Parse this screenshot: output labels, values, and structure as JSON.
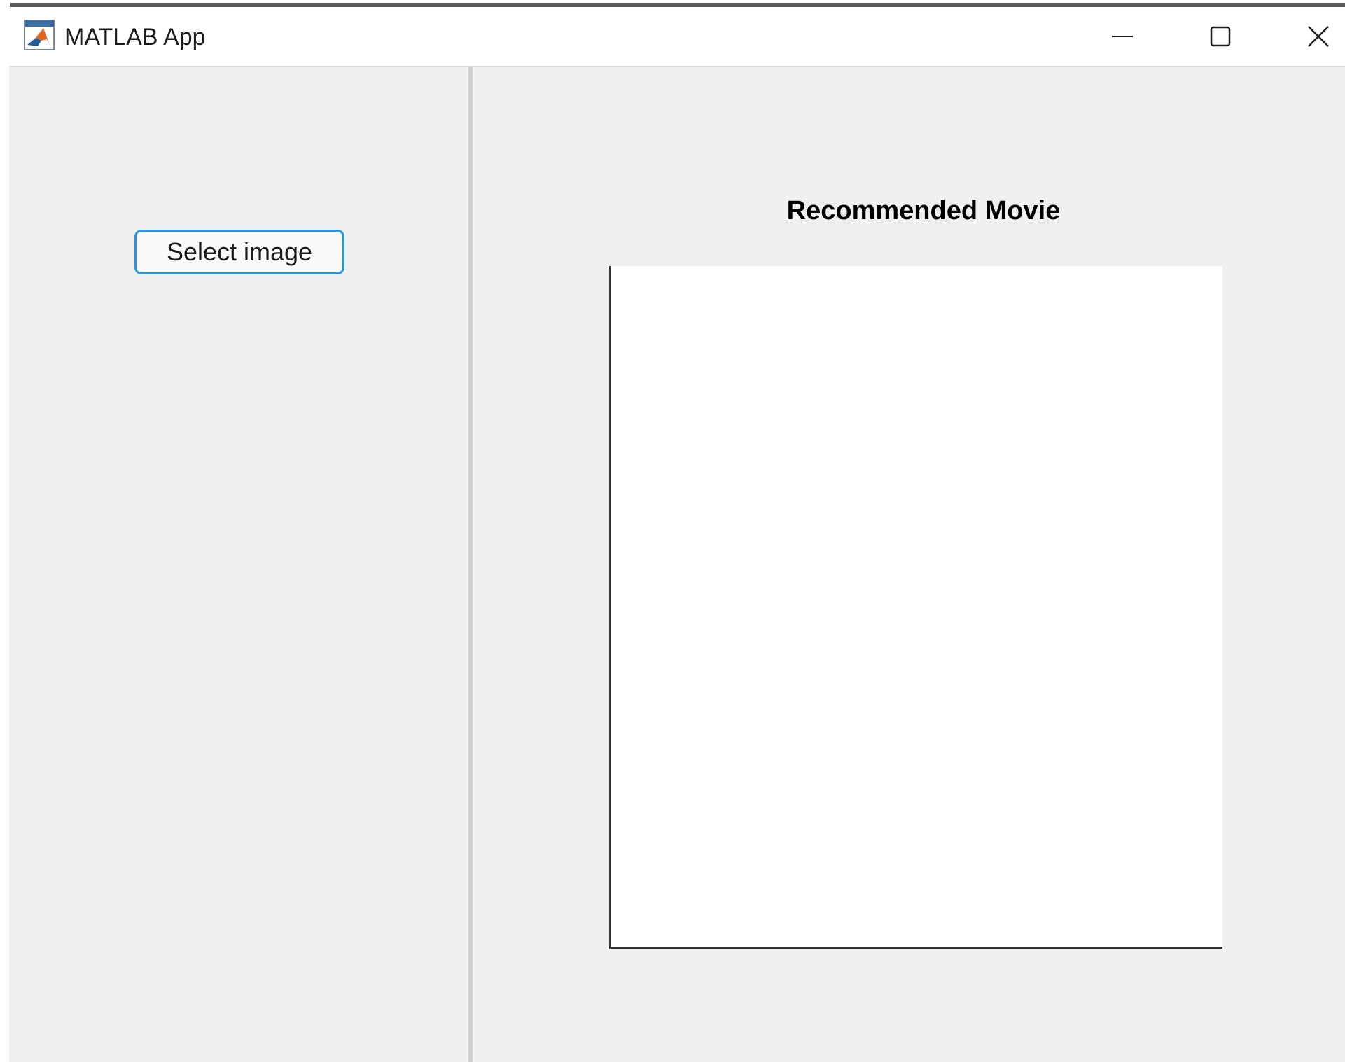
{
  "window": {
    "title": "MATLAB App",
    "controls": {
      "minimize_icon": "minimize-icon",
      "maximize_icon": "maximize-icon",
      "close_icon": "close-icon"
    }
  },
  "left_panel": {
    "select_button_label": "Select image"
  },
  "right_panel": {
    "title": "Recommended Movie",
    "image_content": ""
  },
  "colors": {
    "panel_background": "#f0f0f0",
    "button_border_accent": "#2196f3",
    "titlebar_background": "#ffffff",
    "image_area_background": "#ffffff"
  }
}
